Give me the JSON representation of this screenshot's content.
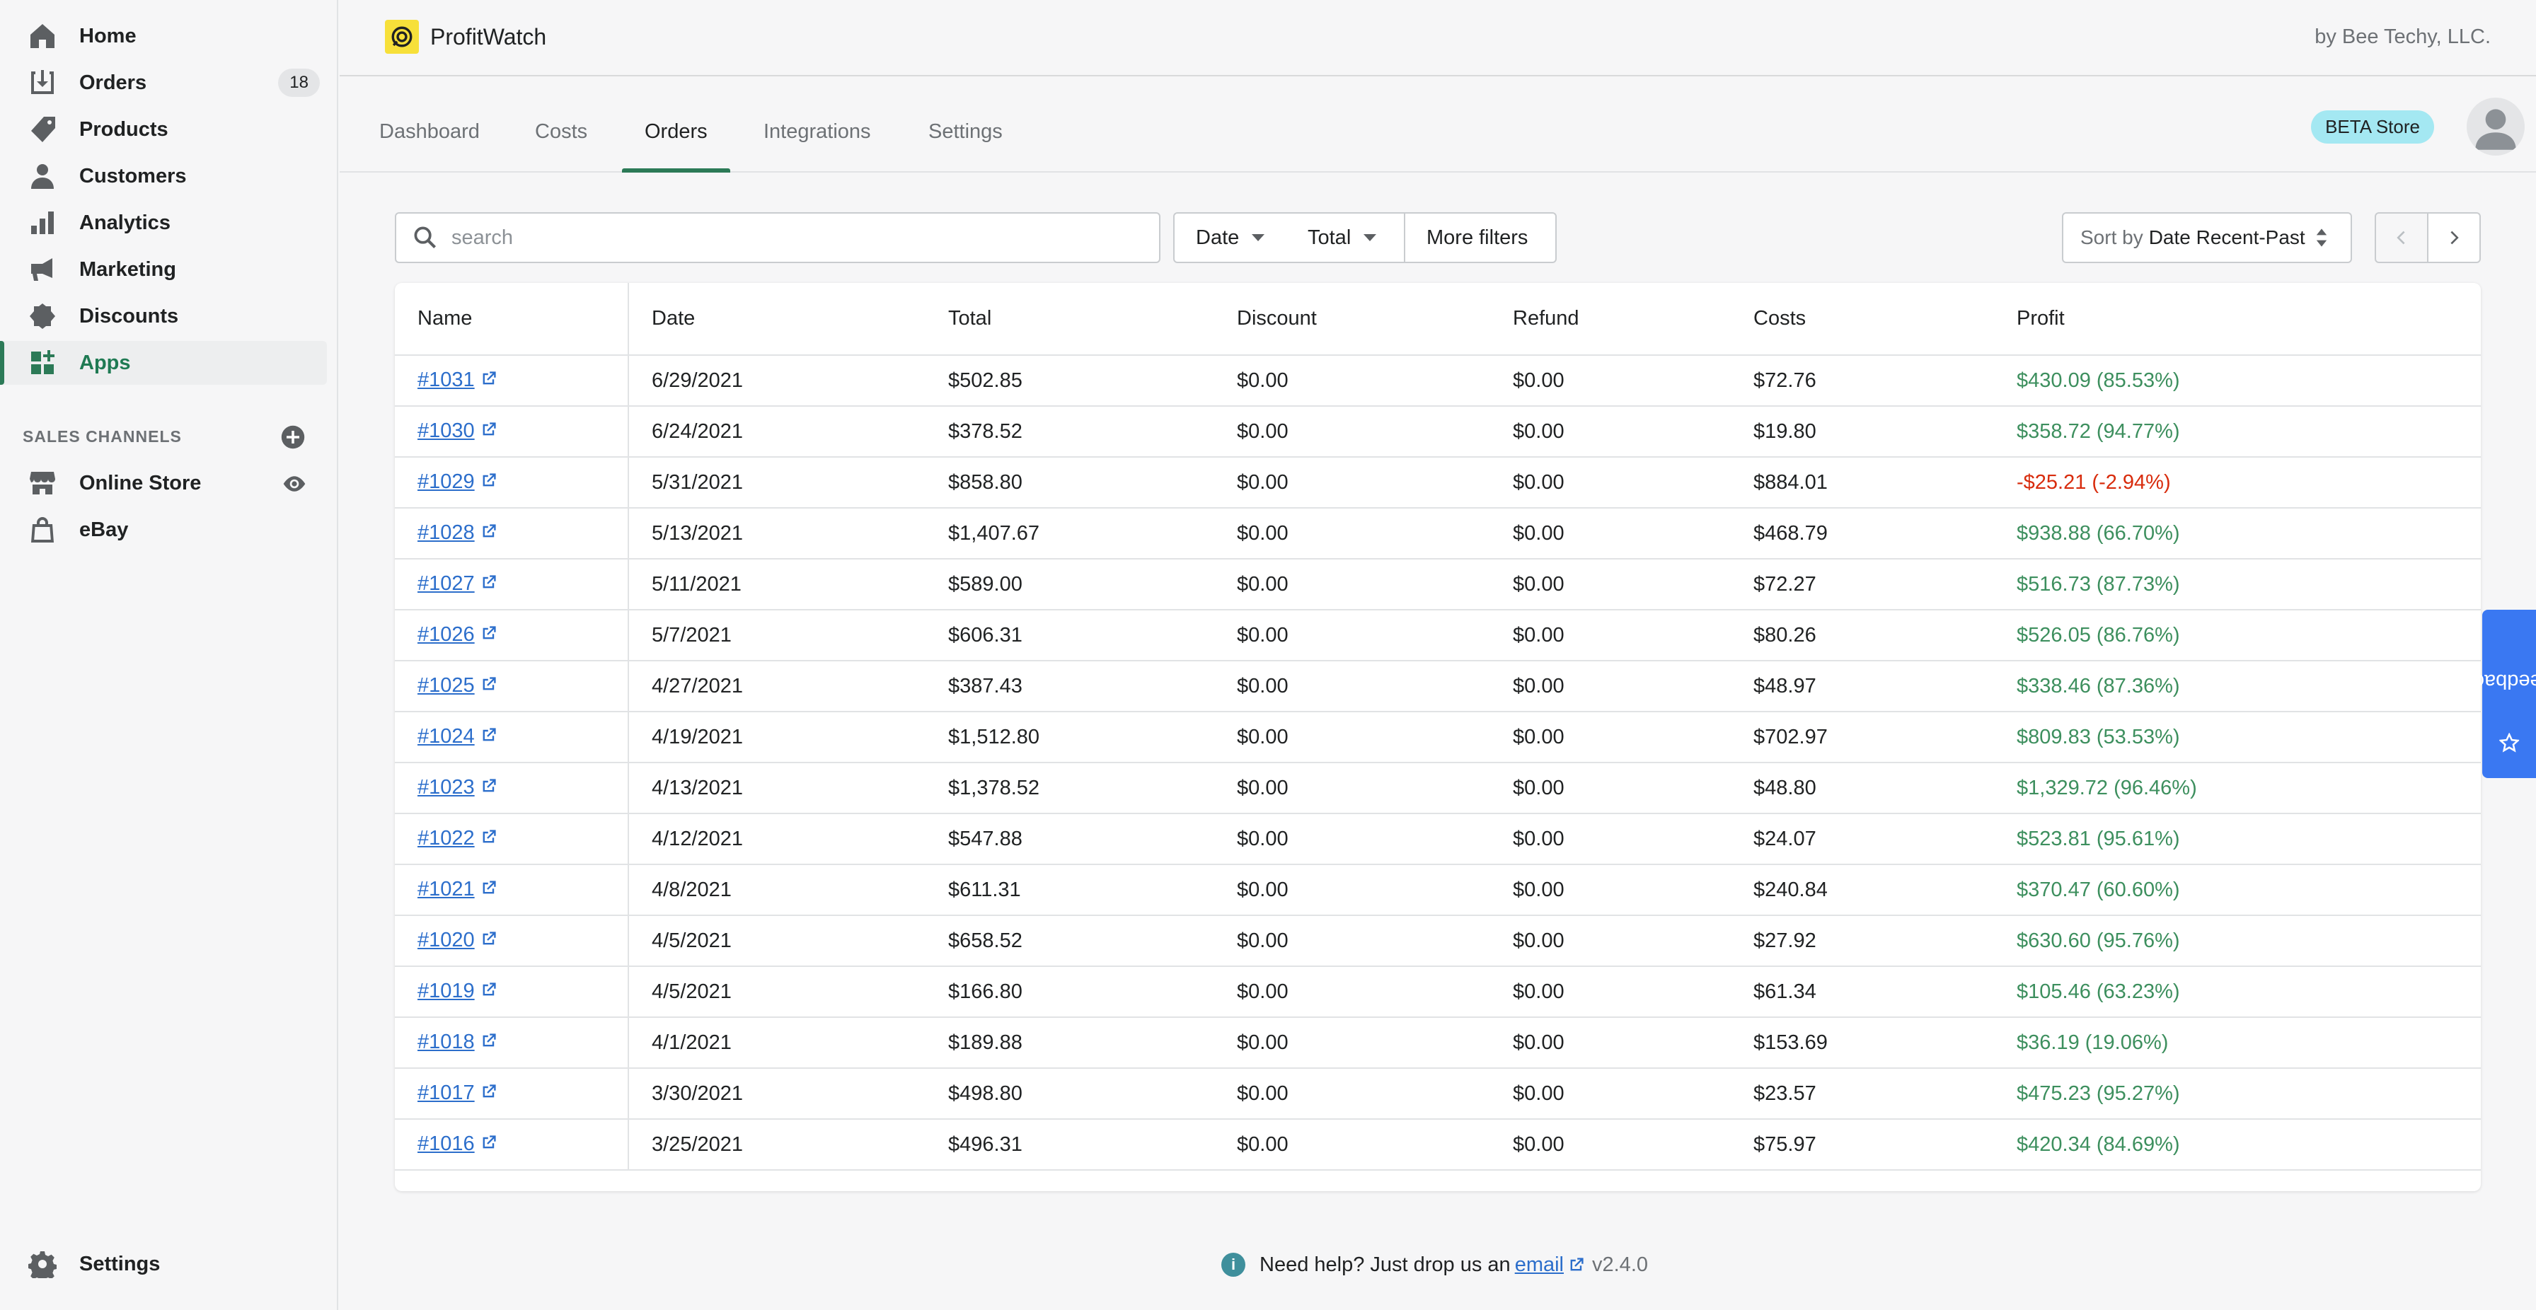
{
  "sidebar": {
    "items": [
      {
        "label": "Home",
        "icon": "home-icon"
      },
      {
        "label": "Orders",
        "icon": "orders-icon",
        "badge": "18"
      },
      {
        "label": "Products",
        "icon": "tag-icon"
      },
      {
        "label": "Customers",
        "icon": "person-icon"
      },
      {
        "label": "Analytics",
        "icon": "bar-chart-icon"
      },
      {
        "label": "Marketing",
        "icon": "megaphone-icon"
      },
      {
        "label": "Discounts",
        "icon": "discount-icon"
      },
      {
        "label": "Apps",
        "icon": "apps-icon",
        "active": true
      }
    ],
    "sales_channels_label": "SALES CHANNELS",
    "channels": [
      {
        "label": "Online Store",
        "icon": "store-icon"
      },
      {
        "label": "eBay",
        "icon": "bag-icon"
      }
    ],
    "settings_label": "Settings"
  },
  "topbar": {
    "app_name": "ProfitWatch",
    "vendor": "by Bee Techy, LLC."
  },
  "tabs": [
    {
      "label": "Dashboard"
    },
    {
      "label": "Costs"
    },
    {
      "label": "Orders",
      "active": true
    },
    {
      "label": "Integrations"
    },
    {
      "label": "Settings"
    }
  ],
  "beta_badge": "BETA Store",
  "filters": {
    "search_placeholder": "search",
    "date_label": "Date",
    "total_label": "Total",
    "more_filters_label": "More filters",
    "sort_prefix": "Sort by",
    "sort_value": "Date Recent-Past"
  },
  "table": {
    "headers": [
      "Name",
      "Date",
      "Total",
      "Discount",
      "Refund",
      "Costs",
      "Profit"
    ],
    "rows": [
      {
        "name": "#1031",
        "date": "6/29/2021",
        "total": "$502.85",
        "discount": "$0.00",
        "refund": "$0.00",
        "costs": "$72.76",
        "profit": "$430.09 (85.53%)",
        "negative": false
      },
      {
        "name": "#1030",
        "date": "6/24/2021",
        "total": "$378.52",
        "discount": "$0.00",
        "refund": "$0.00",
        "costs": "$19.80",
        "profit": "$358.72 (94.77%)",
        "negative": false
      },
      {
        "name": "#1029",
        "date": "5/31/2021",
        "total": "$858.80",
        "discount": "$0.00",
        "refund": "$0.00",
        "costs": "$884.01",
        "profit": "-$25.21 (-2.94%)",
        "negative": true
      },
      {
        "name": "#1028",
        "date": "5/13/2021",
        "total": "$1,407.67",
        "discount": "$0.00",
        "refund": "$0.00",
        "costs": "$468.79",
        "profit": "$938.88 (66.70%)",
        "negative": false
      },
      {
        "name": "#1027",
        "date": "5/11/2021",
        "total": "$589.00",
        "discount": "$0.00",
        "refund": "$0.00",
        "costs": "$72.27",
        "profit": "$516.73 (87.73%)",
        "negative": false
      },
      {
        "name": "#1026",
        "date": "5/7/2021",
        "total": "$606.31",
        "discount": "$0.00",
        "refund": "$0.00",
        "costs": "$80.26",
        "profit": "$526.05 (86.76%)",
        "negative": false
      },
      {
        "name": "#1025",
        "date": "4/27/2021",
        "total": "$387.43",
        "discount": "$0.00",
        "refund": "$0.00",
        "costs": "$48.97",
        "profit": "$338.46 (87.36%)",
        "negative": false
      },
      {
        "name": "#1024",
        "date": "4/19/2021",
        "total": "$1,512.80",
        "discount": "$0.00",
        "refund": "$0.00",
        "costs": "$702.97",
        "profit": "$809.83 (53.53%)",
        "negative": false
      },
      {
        "name": "#1023",
        "date": "4/13/2021",
        "total": "$1,378.52",
        "discount": "$0.00",
        "refund": "$0.00",
        "costs": "$48.80",
        "profit": "$1,329.72 (96.46%)",
        "negative": false
      },
      {
        "name": "#1022",
        "date": "4/12/2021",
        "total": "$547.88",
        "discount": "$0.00",
        "refund": "$0.00",
        "costs": "$24.07",
        "profit": "$523.81 (95.61%)",
        "negative": false
      },
      {
        "name": "#1021",
        "date": "4/8/2021",
        "total": "$611.31",
        "discount": "$0.00",
        "refund": "$0.00",
        "costs": "$240.84",
        "profit": "$370.47 (60.60%)",
        "negative": false
      },
      {
        "name": "#1020",
        "date": "4/5/2021",
        "total": "$658.52",
        "discount": "$0.00",
        "refund": "$0.00",
        "costs": "$27.92",
        "profit": "$630.60 (95.76%)",
        "negative": false
      },
      {
        "name": "#1019",
        "date": "4/5/2021",
        "total": "$166.80",
        "discount": "$0.00",
        "refund": "$0.00",
        "costs": "$61.34",
        "profit": "$105.46 (63.23%)",
        "negative": false
      },
      {
        "name": "#1018",
        "date": "4/1/2021",
        "total": "$189.88",
        "discount": "$0.00",
        "refund": "$0.00",
        "costs": "$153.69",
        "profit": "$36.19 (19.06%)",
        "negative": false
      },
      {
        "name": "#1017",
        "date": "3/30/2021",
        "total": "$498.80",
        "discount": "$0.00",
        "refund": "$0.00",
        "costs": "$23.57",
        "profit": "$475.23 (95.27%)",
        "negative": false
      },
      {
        "name": "#1016",
        "date": "3/25/2021",
        "total": "$496.31",
        "discount": "$0.00",
        "refund": "$0.00",
        "costs": "$75.97",
        "profit": "$420.34 (84.69%)",
        "negative": false
      }
    ]
  },
  "feedback_label": "Feedback",
  "footer": {
    "help_text": "Need help? Just drop us an",
    "email_link": "email",
    "version": "v2.4.0"
  },
  "colors": {
    "accent_green": "#2c7a57",
    "link_blue": "#2c6ecb",
    "profit_positive": "#3d8f5e",
    "profit_negative": "#d82c0d",
    "feedback_blue": "#3a78f2",
    "logo_yellow": "#f7e03a",
    "beta_badge": "#a4e8f2"
  }
}
